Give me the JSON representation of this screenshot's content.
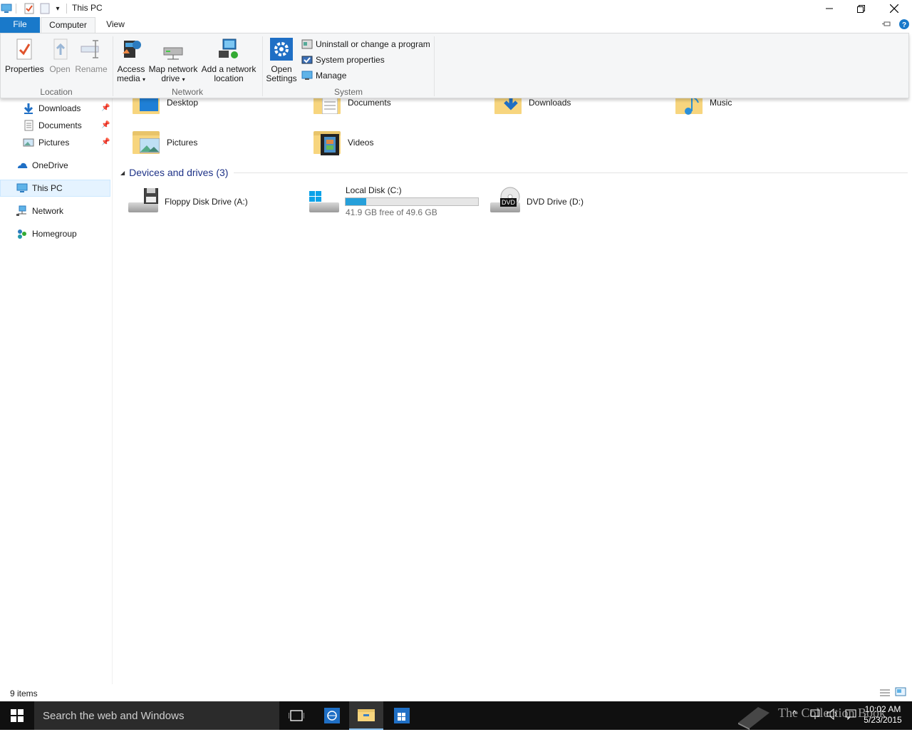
{
  "window": {
    "title": "This PC"
  },
  "ribbon_tabs": {
    "file": "File",
    "computer": "Computer",
    "view": "View"
  },
  "ribbon": {
    "location": {
      "group_label": "Location",
      "properties": "Properties",
      "open": "Open",
      "rename": "Rename"
    },
    "network": {
      "group_label": "Network",
      "access_media_line1": "Access",
      "access_media_line2": "media",
      "map_drive_line1": "Map network",
      "map_drive_line2": "drive",
      "add_location_line1": "Add a network",
      "add_location_line2": "location"
    },
    "system": {
      "group_label": "System",
      "open_settings_line1": "Open",
      "open_settings_line2": "Settings",
      "uninstall": "Uninstall or change a program",
      "system_properties": "System properties",
      "manage": "Manage"
    }
  },
  "nav": {
    "items": [
      {
        "label": "Downloads",
        "pinned": true
      },
      {
        "label": "Documents",
        "pinned": true
      },
      {
        "label": "Pictures",
        "pinned": true
      },
      {
        "label": "OneDrive"
      },
      {
        "label": "This PC",
        "selected": true
      },
      {
        "label": "Network"
      },
      {
        "label": "Homegroup"
      }
    ]
  },
  "folders": [
    {
      "label": "Desktop"
    },
    {
      "label": "Documents"
    },
    {
      "label": "Downloads"
    },
    {
      "label": "Music"
    },
    {
      "label": "Pictures"
    },
    {
      "label": "Videos"
    }
  ],
  "devices": {
    "header": "Devices and drives (3)",
    "floppy": {
      "label": "Floppy Disk Drive (A:)"
    },
    "local": {
      "label": "Local Disk (C:)",
      "free_text": "41.9 GB free of 49.6 GB",
      "used_fraction": 0.155
    },
    "dvd": {
      "label": "DVD Drive (D:)",
      "badge": "DVD"
    }
  },
  "status": {
    "items": "9 items"
  },
  "taskbar": {
    "search_placeholder": "Search the web and Windows",
    "time": "10:02 AM",
    "date": "5/23/2015",
    "watermark": "The Collection Book"
  },
  "colors": {
    "accent": "#1979ca",
    "selection": "#e5f3ff",
    "disk_fill": "#26a0da"
  }
}
